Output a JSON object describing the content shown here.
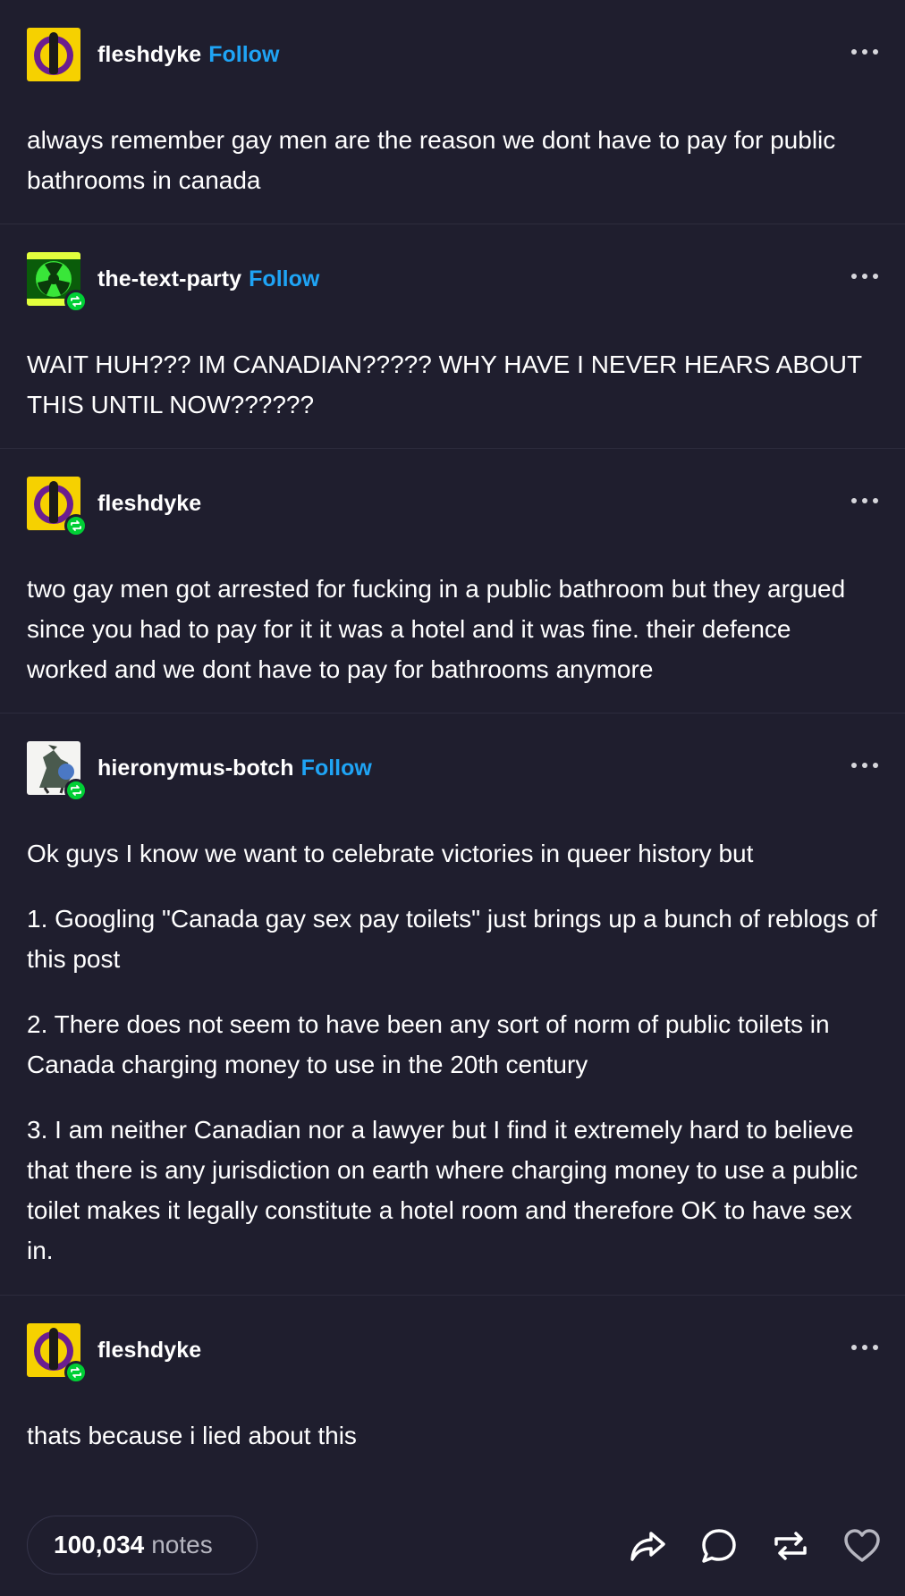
{
  "posts": [
    {
      "username": "fleshdyke",
      "follow_label": "Follow",
      "paragraphs": [
        "always remember gay men are the reason we dont have to pay for public bathrooms in canada"
      ]
    },
    {
      "username": "the-text-party",
      "follow_label": "Follow",
      "paragraphs": [
        "WAIT HUH??? IM CANADIAN????? WHY HAVE I NEVER HEARS ABOUT THIS UNTIL NOW??????"
      ]
    },
    {
      "username": "fleshdyke",
      "paragraphs": [
        "two gay men got arrested for fucking in a public bathroom but they argued since you had to pay for it it was a hotel and it was fine. their defence worked and we dont have to pay for bathrooms anymore"
      ]
    },
    {
      "username": "hieronymus-botch",
      "follow_label": "Follow",
      "paragraphs": [
        "Ok guys I know we want to celebrate victories in queer history but",
        "1. Googling \"Canada gay sex pay toilets\" just brings up a bunch of reblogs of this post",
        "2. There does not seem to have been any sort of norm of public toilets in Canada charging money to use in the 20th century",
        "3. I am neither Canadian nor a lawyer but I find it extremely hard to believe that there is any jurisdiction on earth where charging money to use a public toilet makes it legally constitute a hotel room and therefore OK to have sex in."
      ]
    },
    {
      "username": "fleshdyke",
      "paragraphs": [
        "thats because i lied about this"
      ]
    }
  ],
  "footer": {
    "notes_count": "100,034",
    "notes_label": "notes",
    "actions": [
      "share-icon",
      "reply-icon",
      "reblog-icon",
      "like-icon"
    ]
  },
  "colors": {
    "background": "#1f1e2e",
    "follow": "#1fa4f5",
    "reblog_badge": "#00cf35",
    "text": "#ffffff"
  }
}
